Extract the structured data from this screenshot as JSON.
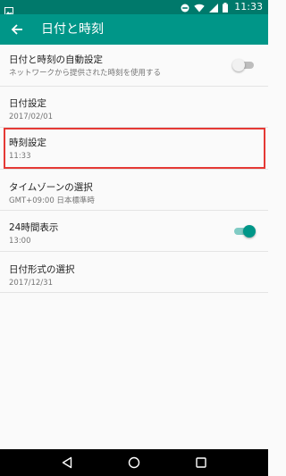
{
  "status_bar": {
    "time": "11:33"
  },
  "app_bar": {
    "title": "日付と時刻"
  },
  "settings": [
    {
      "title": "日付と時刻の自動設定",
      "subtitle": "ネットワークから提供された時刻を使用する",
      "switch": "off"
    },
    {
      "title": "日付設定",
      "subtitle": "2017/02/01"
    },
    {
      "title": "時刻設定",
      "subtitle": "11:33"
    },
    {
      "title": "タイムゾーンの選択",
      "subtitle": "GMT+09:00 日本標準時"
    },
    {
      "title": "24時間表示",
      "subtitle": "13:00",
      "switch": "on"
    },
    {
      "title": "日付形式の選択",
      "subtitle": "2017/12/31"
    }
  ],
  "colors": {
    "status_bar": "#00796b",
    "app_bar": "#009688",
    "highlight": "#e53935"
  }
}
